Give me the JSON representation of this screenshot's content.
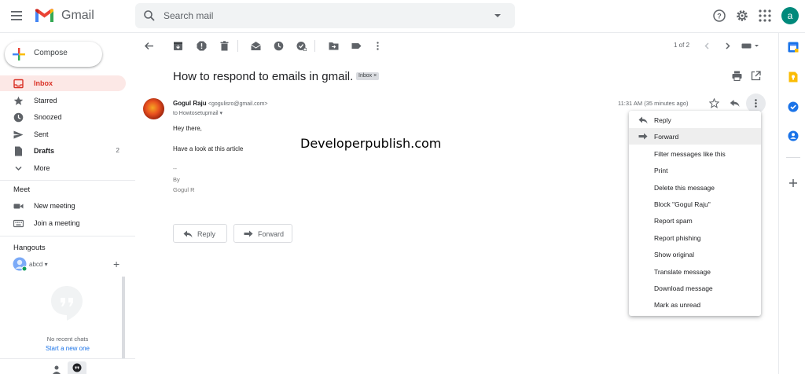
{
  "app": {
    "name": "Gmail"
  },
  "search": {
    "placeholder": "Search mail"
  },
  "compose": {
    "label": "Compose"
  },
  "sidebar": {
    "items": [
      {
        "label": "Inbox",
        "count": ""
      },
      {
        "label": "Starred",
        "count": ""
      },
      {
        "label": "Snoozed",
        "count": ""
      },
      {
        "label": "Sent",
        "count": ""
      },
      {
        "label": "Drafts",
        "count": "2"
      },
      {
        "label": "More",
        "count": ""
      }
    ],
    "meet": {
      "title": "Meet",
      "items": [
        {
          "label": "New meeting"
        },
        {
          "label": "Join a meeting"
        }
      ]
    },
    "hangouts": {
      "title": "Hangouts",
      "user": "abcd",
      "empty_text": "No recent chats",
      "start_link": "Start a new one"
    }
  },
  "toolbar": {
    "pager": "1 of 2"
  },
  "message": {
    "subject": "How to respond to emails in gmail.",
    "label_chip": "Inbox ×",
    "sender_name": "Gogul Raju",
    "sender_email": "<gogulisro@gmail.com>",
    "to_line": "to Howtosetupmail ▾",
    "time": "11:31 AM (35 minutes ago)",
    "body": {
      "greeting": "Hey there,",
      "line1": "Have a look at this article",
      "sig_dash": "--",
      "sig_by": "By",
      "sig_name": "Gogul R"
    },
    "watermark": "Developerpublish.com",
    "reply_label": "Reply",
    "forward_label": "Forward"
  },
  "menu": {
    "items": [
      "Reply",
      "Forward",
      "Filter messages like this",
      "Print",
      "Delete this message",
      "Block \"Gogul Raju\"",
      "Report spam",
      "Report phishing",
      "Show original",
      "Translate message",
      "Download message",
      "Mark as unread"
    ],
    "highlighted_index": 1
  },
  "user": {
    "avatar_letter": "a",
    "avatar_color": "#00897b"
  },
  "colors": {
    "accent_red": "#d93025",
    "active_bg": "#fce8e6"
  }
}
